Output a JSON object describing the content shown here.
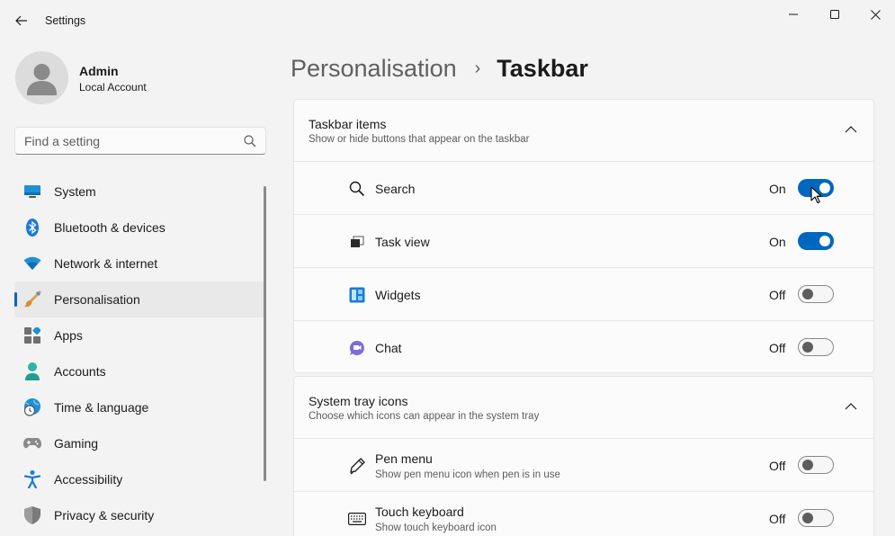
{
  "window": {
    "title": "Settings",
    "minimize_glyph": "—",
    "maximize_glyph": "□",
    "close_glyph": "✕"
  },
  "profile": {
    "name": "Admin",
    "account_type": "Local Account"
  },
  "search": {
    "placeholder": "Find a setting"
  },
  "nav": {
    "items": [
      {
        "label": "System",
        "icon": "monitor-icon"
      },
      {
        "label": "Bluetooth & devices",
        "icon": "bluetooth-icon"
      },
      {
        "label": "Network & internet",
        "icon": "wifi-icon"
      },
      {
        "label": "Personalisation",
        "icon": "paintbrush-icon",
        "active": true
      },
      {
        "label": "Apps",
        "icon": "apps-icon"
      },
      {
        "label": "Accounts",
        "icon": "person-icon"
      },
      {
        "label": "Time & language",
        "icon": "globe-clock-icon"
      },
      {
        "label": "Gaming",
        "icon": "gamepad-icon"
      },
      {
        "label": "Accessibility",
        "icon": "accessibility-icon"
      },
      {
        "label": "Privacy & security",
        "icon": "shield-icon"
      }
    ]
  },
  "breadcrumb": {
    "parent": "Personalisation",
    "separator": "›",
    "current": "Taskbar"
  },
  "sections": {
    "taskbar_items": {
      "title": "Taskbar items",
      "subtitle": "Show or hide buttons that appear on the taskbar",
      "rows": [
        {
          "label": "Search",
          "state": "On",
          "on": true,
          "icon": "search-icon"
        },
        {
          "label": "Task view",
          "state": "On",
          "on": true,
          "icon": "task-view-icon"
        },
        {
          "label": "Widgets",
          "state": "Off",
          "on": false,
          "icon": "widgets-icon"
        },
        {
          "label": "Chat",
          "state": "Off",
          "on": false,
          "icon": "chat-icon"
        }
      ]
    },
    "system_tray": {
      "title": "System tray icons",
      "subtitle": "Choose which icons can appear in the system tray",
      "rows": [
        {
          "label": "Pen menu",
          "sub": "Show pen menu icon when pen is in use",
          "state": "Off",
          "on": false,
          "icon": "pen-icon"
        },
        {
          "label": "Touch keyboard",
          "sub": "Show touch keyboard icon",
          "state": "Off",
          "on": false,
          "icon": "keyboard-icon"
        }
      ]
    }
  },
  "colors": {
    "accent": "#0067c0",
    "background": "#f3f3f3",
    "card": "#fbfbfb"
  }
}
